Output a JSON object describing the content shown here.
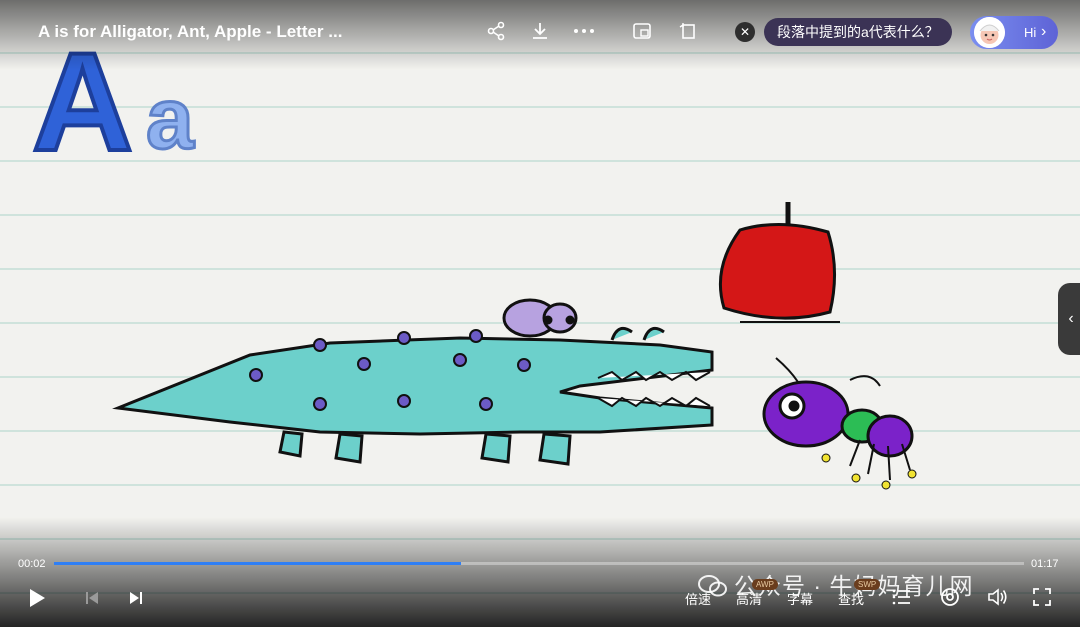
{
  "video": {
    "title": "A is for Alligator, Ant, Apple - Letter ...",
    "letters": {
      "upper": "A",
      "lower": "a"
    }
  },
  "topbar": {
    "question": "段落中提到的a代表什么？",
    "hi_label": "Hi",
    "icons": [
      "share-icon",
      "download-icon",
      "more-icon",
      "picture-in-picture-icon",
      "rotate-icon",
      "close-icon"
    ]
  },
  "player": {
    "current_time": "00:02",
    "duration": "01:17",
    "progress_fraction": 0.42,
    "accent_color": "#2f7ff5",
    "controls": {
      "speed_label": "倍速",
      "quality_label": "高清",
      "subtitle_label": "字幕",
      "find_label": "查找"
    },
    "tags": {
      "tag1": "AWP",
      "tag2": "SWP"
    }
  },
  "watermark": {
    "text": "公众号 · 牛妈妈育儿网"
  }
}
